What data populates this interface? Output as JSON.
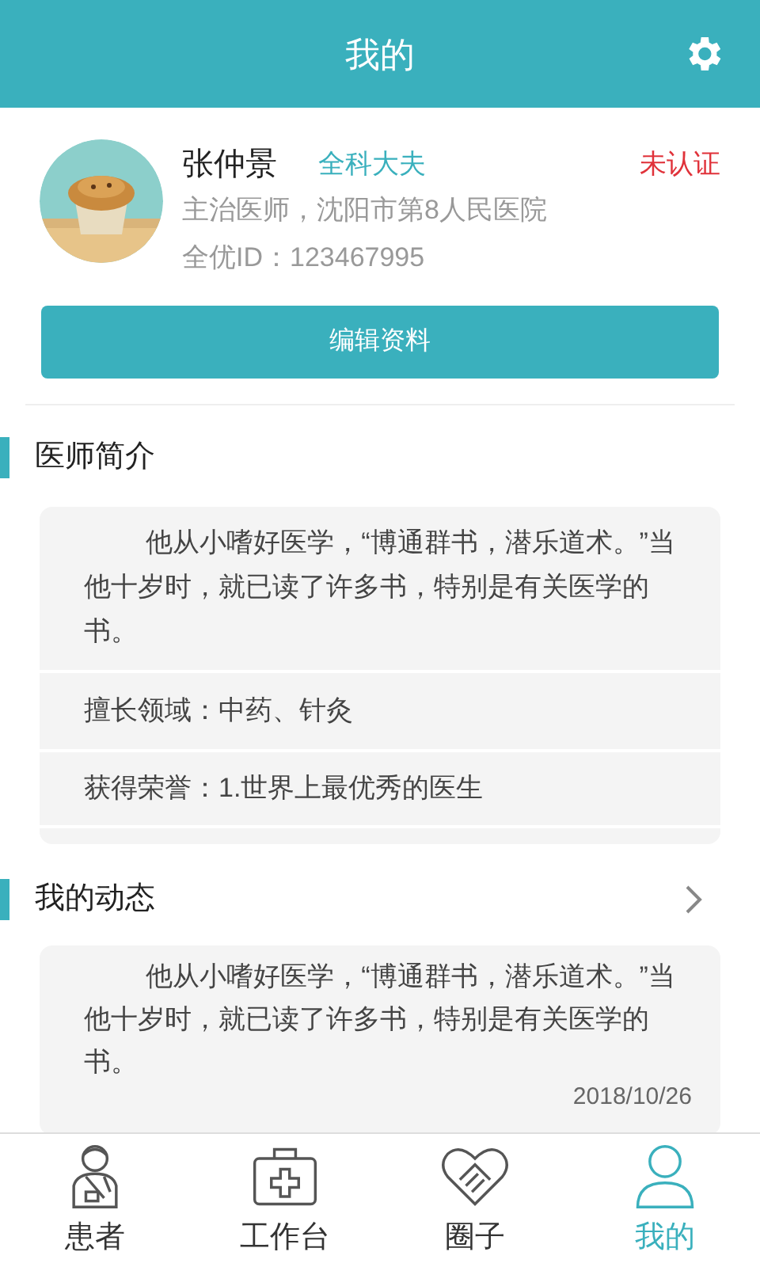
{
  "header": {
    "title": "我的"
  },
  "profile": {
    "name": "张仲景",
    "department": "全科大夫",
    "verification": "未认证",
    "position": "主治医师，沈阳市第8人民医院",
    "id": "全优ID：123467995"
  },
  "edit_button": "编辑资料",
  "intro": {
    "title": "医师简介",
    "bio": "他从小嗜好医学，“博通群书，潜乐道术。”当他十岁时，就已读了许多书，特别是有关医学的书。",
    "specialty": "擅长领域：中药、针灸",
    "honors": "获得荣誉：1.世界上最优秀的医生"
  },
  "feed": {
    "title": "我的动态",
    "post": {
      "text": "他从小嗜好医学，“博通群书，潜乐道术。”当他十岁时，就已读了许多书，特别是有关医学的书。",
      "date": "2018/10/26"
    }
  },
  "tabs": [
    {
      "label": "患者",
      "kind": "patient",
      "selected": false
    },
    {
      "label": "工作台",
      "kind": "workbench",
      "selected": false
    },
    {
      "label": "圈子",
      "kind": "circle",
      "selected": false
    },
    {
      "label": "我的",
      "kind": "me",
      "selected": true
    }
  ]
}
